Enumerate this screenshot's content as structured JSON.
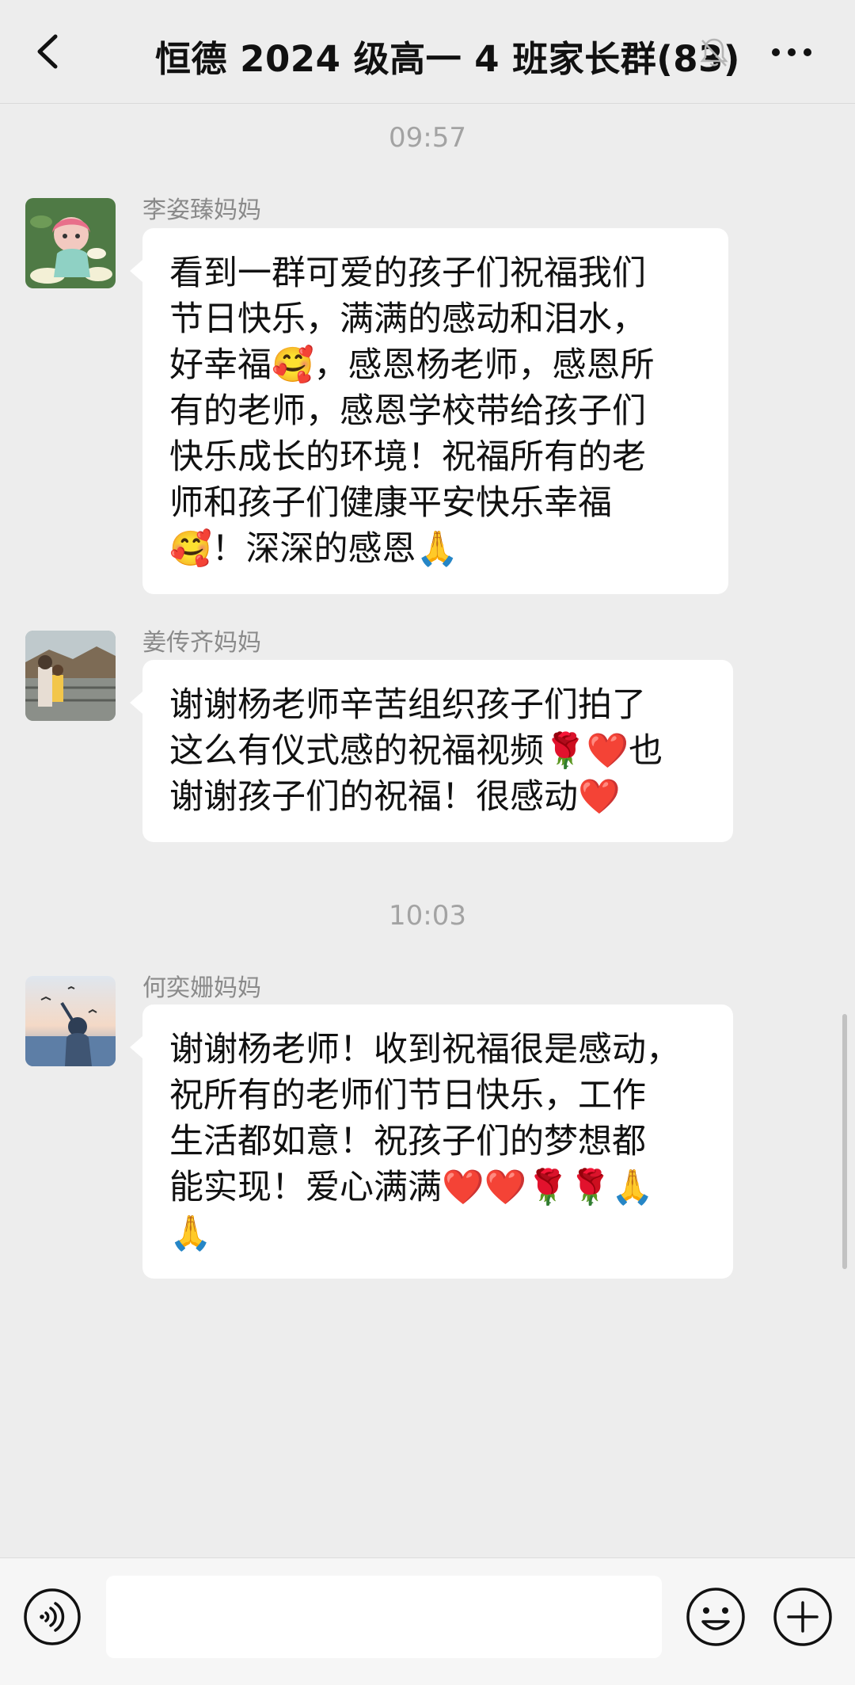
{
  "header": {
    "title": "恒德 2024 级高一 4 班家长群(83)",
    "back_icon": "chevron-left-icon",
    "mute_icon": "bell-off-icon",
    "more_icon": "more-dots-icon"
  },
  "chat": {
    "times": [
      "09:57",
      "10:03"
    ],
    "messages": [
      {
        "sender": "李姿臻妈妈",
        "avatar": "avatar-cartoon-girl-lotus",
        "text": "看到一群可爱的孩子们祝福我们\n节日快乐，满满的感动和泪水，\n好幸福🥰，感恩杨老师，感恩所\n有的老师，感恩学校带给孩子们\n快乐成长的环境！祝福所有的老\n师和孩子们健康平安快乐幸福\n🥰！深深的感恩🙏"
      },
      {
        "sender": "姜传齐妈妈",
        "avatar": "avatar-family-photo",
        "text": "谢谢杨老师辛苦组织孩子们拍了\n这么有仪式感的祝福视频🌹❤️也\n谢谢孩子们的祝福！很感动❤️"
      },
      {
        "sender": "何奕姗妈妈",
        "avatar": "avatar-girl-seaside-birds",
        "text": "谢谢杨老师！收到祝福很是感动，\n祝所有的老师们节日快乐，工作\n生活都如意！祝孩子们的梦想都\n能实现！爱心满满❤️❤️🌹🌹🙏\n🙏"
      }
    ]
  },
  "input_bar": {
    "voice_icon": "voice-icon",
    "input_value": "",
    "emoji_icon": "emoji-icon",
    "plus_icon": "plus-icon"
  },
  "colors": {
    "background": "#ededed",
    "bubble": "#ffffff",
    "timestamp": "#a3a3a3",
    "sender": "#8a8a8a"
  }
}
